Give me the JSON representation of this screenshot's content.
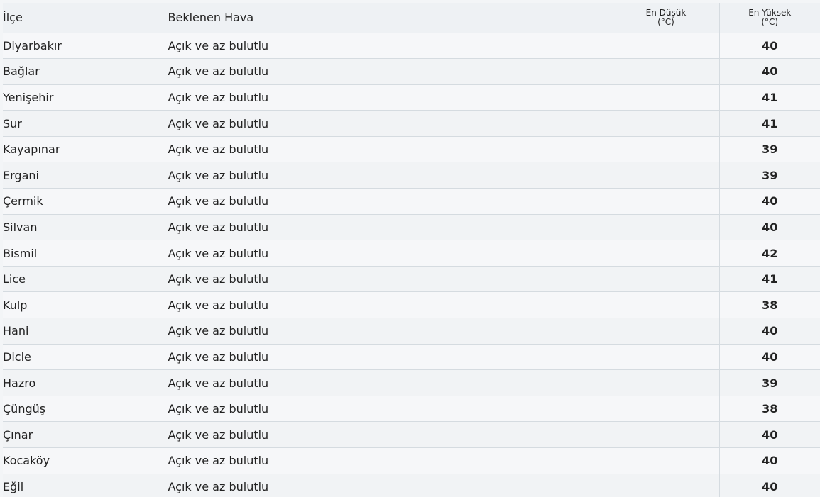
{
  "header": {
    "district": "İlçe",
    "weather": "Beklenen Hava",
    "min_line1": "En Düşük",
    "min_line2": "(°C)",
    "max_line1": "En Yüksek",
    "max_line2": "(°C)"
  },
  "colors": {
    "max_temp": "#d0393b",
    "grid_line": "#d5dbe0"
  },
  "rows": [
    {
      "district": "Diyarbakır",
      "weather": "Açık ve az bulutlu",
      "min": "",
      "max": "40"
    },
    {
      "district": "Bağlar",
      "weather": "Açık ve az bulutlu",
      "min": "",
      "max": "40"
    },
    {
      "district": "Yenişehir",
      "weather": "Açık ve az bulutlu",
      "min": "",
      "max": "41"
    },
    {
      "district": "Sur",
      "weather": "Açık ve az bulutlu",
      "min": "",
      "max": "41"
    },
    {
      "district": "Kayapınar",
      "weather": "Açık ve az bulutlu",
      "min": "",
      "max": "39"
    },
    {
      "district": "Ergani",
      "weather": "Açık ve az bulutlu",
      "min": "",
      "max": "39"
    },
    {
      "district": "Çermik",
      "weather": "Açık ve az bulutlu",
      "min": "",
      "max": "40"
    },
    {
      "district": "Silvan",
      "weather": "Açık ve az bulutlu",
      "min": "",
      "max": "40"
    },
    {
      "district": "Bismil",
      "weather": "Açık ve az bulutlu",
      "min": "",
      "max": "42"
    },
    {
      "district": "Lice",
      "weather": "Açık ve az bulutlu",
      "min": "",
      "max": "41"
    },
    {
      "district": "Kulp",
      "weather": "Açık ve az bulutlu",
      "min": "",
      "max": "38"
    },
    {
      "district": "Hani",
      "weather": "Açık ve az bulutlu",
      "min": "",
      "max": "40"
    },
    {
      "district": "Dicle",
      "weather": "Açık ve az bulutlu",
      "min": "",
      "max": "40"
    },
    {
      "district": "Hazro",
      "weather": "Açık ve az bulutlu",
      "min": "",
      "max": "39"
    },
    {
      "district": "Çüngüş",
      "weather": "Açık ve az bulutlu",
      "min": "",
      "max": "38"
    },
    {
      "district": "Çınar",
      "weather": "Açık ve az bulutlu",
      "min": "",
      "max": "40"
    },
    {
      "district": "Kocaköy",
      "weather": "Açık ve az bulutlu",
      "min": "",
      "max": "40"
    },
    {
      "district": "Eğil",
      "weather": "Açık ve az bulutlu",
      "min": "",
      "max": "40"
    }
  ]
}
